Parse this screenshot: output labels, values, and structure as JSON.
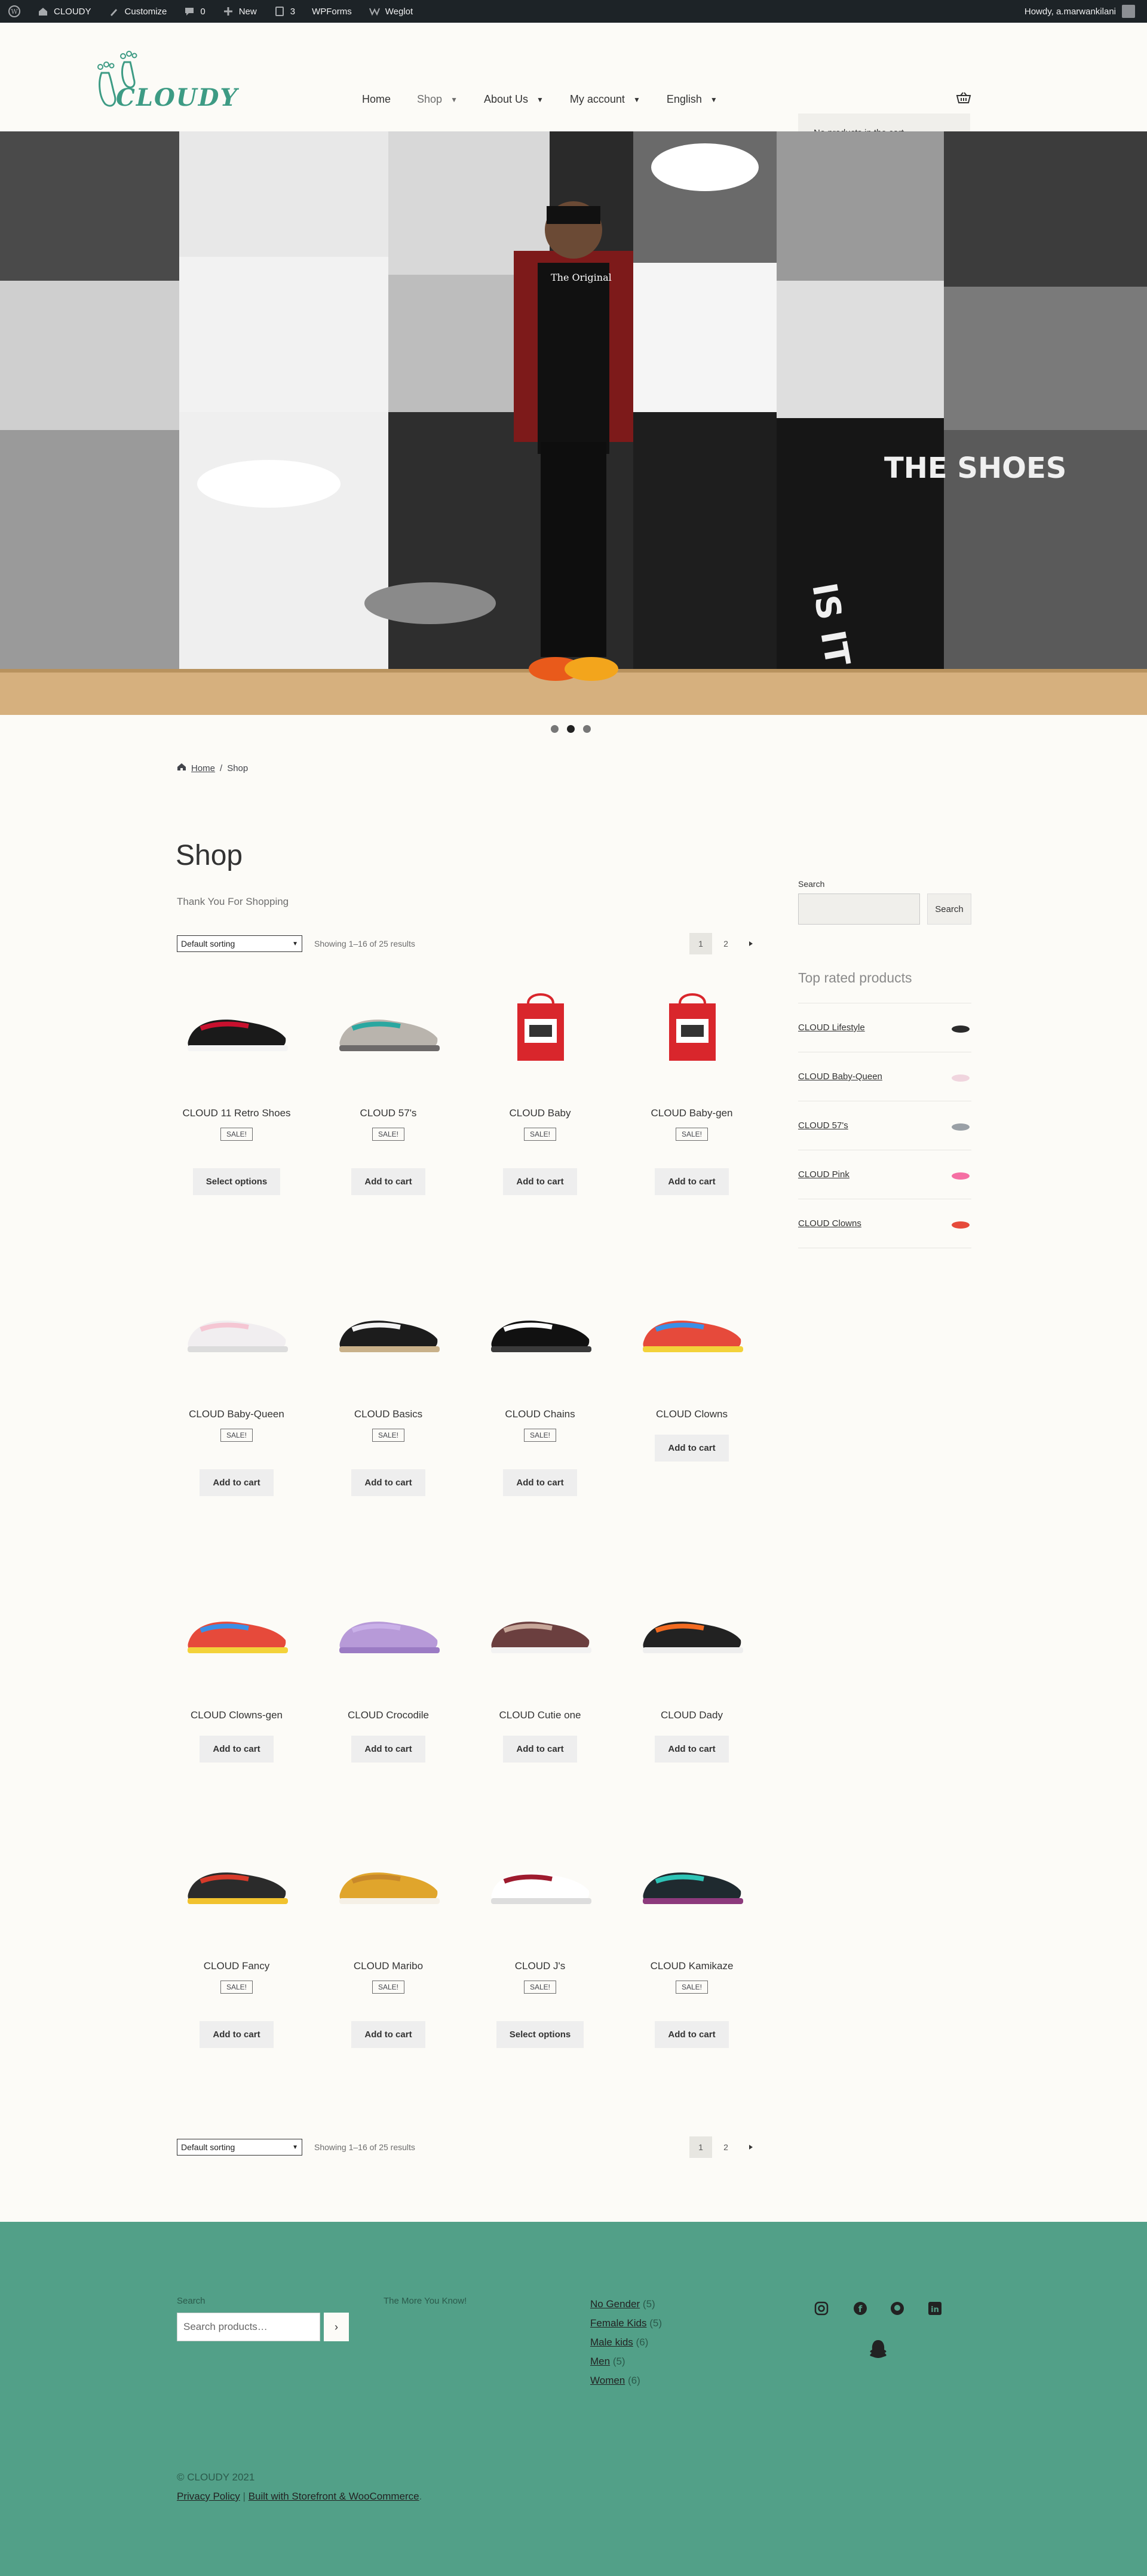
{
  "admin_bar": {
    "site_name": "CLOUDY",
    "customize": "Customize",
    "comments_count": "0",
    "new_label": "New",
    "updates_count": "3",
    "wpforms": "WPForms",
    "weglot": "Weglot",
    "howdy": "Howdy, a.marwankilani"
  },
  "header": {
    "logo_text": "CLOUDY",
    "nav": [
      "Home",
      "Shop",
      "About Us",
      "My account",
      "English"
    ],
    "cart_message": "No products in the cart."
  },
  "breadcrumb": {
    "home": "Home",
    "separator": "/",
    "current": "Shop"
  },
  "page": {
    "title": "Shop",
    "subtitle": "Thank You For Shopping"
  },
  "toolbar": {
    "sort_value": "Default sorting",
    "result_count": "Showing 1–16 of 25 results",
    "pages": [
      "1",
      "2"
    ],
    "next": "→"
  },
  "products": [
    {
      "name": "CLOUD 11 Retro Shoes",
      "sale": "SALE!",
      "button": "Select options",
      "colors": [
        "#1a1a1a",
        "#c8102e",
        "#f4f4f4"
      ]
    },
    {
      "name": "CLOUD 57's",
      "sale": "SALE!",
      "button": "Add to cart",
      "colors": [
        "#b9b4ad",
        "#2aa7a0",
        "#6d6a6a"
      ]
    },
    {
      "name": "CLOUD Baby",
      "sale": "SALE!",
      "button": "Add to cart",
      "colors": [
        "#d9262c",
        "#ffffff",
        "#333333"
      ]
    },
    {
      "name": "CLOUD Baby-gen",
      "sale": "SALE!",
      "button": "Add to cart",
      "colors": [
        "#d9262c",
        "#ffffff",
        "#333333"
      ]
    },
    {
      "name": "CLOUD Baby-Queen",
      "sale": "SALE!",
      "button": "Add to cart",
      "colors": [
        "#f1eef0",
        "#f5c6d3",
        "#dcdcdc"
      ]
    },
    {
      "name": "CLOUD Basics",
      "sale": "SALE!",
      "button": "Add to cart",
      "colors": [
        "#1c1c1c",
        "#f4f4f4",
        "#c9b18a"
      ]
    },
    {
      "name": "CLOUD Chains",
      "sale": "SALE!",
      "button": "Add to cart",
      "colors": [
        "#111111",
        "#ffffff",
        "#3a3a3a"
      ]
    },
    {
      "name": "CLOUD Clowns",
      "sale": "",
      "button": "Add to cart",
      "colors": [
        "#e64a3b",
        "#3b8fe6",
        "#f3d23a"
      ]
    },
    {
      "name": "CLOUD Clowns-gen",
      "sale": "",
      "button": "Add to cart",
      "colors": [
        "#e64a3b",
        "#3b8fe6",
        "#f3d23a"
      ]
    },
    {
      "name": "CLOUD Crocodile",
      "sale": "",
      "button": "Add to cart",
      "colors": [
        "#b79ad8",
        "#c9b0e8",
        "#9b7bc4"
      ]
    },
    {
      "name": "CLOUD Cutie one",
      "sale": "",
      "button": "Add to cart",
      "colors": [
        "#6b3f3f",
        "#c7a79a",
        "#f2f2f2"
      ]
    },
    {
      "name": "CLOUD Dady",
      "sale": "",
      "button": "Add to cart",
      "colors": [
        "#222222",
        "#f36b21",
        "#eeeeee"
      ]
    },
    {
      "name": "CLOUD Fancy",
      "sale": "SALE!",
      "button": "Add to cart",
      "colors": [
        "#2b2b2b",
        "#d73a2a",
        "#f1c22e"
      ]
    },
    {
      "name": "CLOUD Maribo",
      "sale": "SALE!",
      "button": "Add to cart",
      "colors": [
        "#e0a52c",
        "#c8882a",
        "#f5f0e6"
      ]
    },
    {
      "name": "CLOUD J's",
      "sale": "SALE!",
      "button": "Select options",
      "colors": [
        "#ffffff",
        "#9e1b2e",
        "#dddddd"
      ]
    },
    {
      "name": "CLOUD Kamikaze",
      "sale": "SALE!",
      "button": "Add to cart",
      "colors": [
        "#1f2a2f",
        "#2ec4b6",
        "#8c3a7c"
      ]
    }
  ],
  "sidebar": {
    "search_label": "Search",
    "search_button": "Search",
    "top_rated_title": "Top rated products",
    "top_rated": [
      "CLOUD Lifestyle",
      "CLOUD Baby-Queen",
      "CLOUD 57's",
      "CLOUD Pink",
      "CLOUD Clowns"
    ]
  },
  "footer": {
    "search_label": "Search",
    "search_placeholder": "Search products…",
    "search_button": "›",
    "tagline": "The More You Know!",
    "categories": [
      {
        "name": "No Gender",
        "count": "(5)"
      },
      {
        "name": "Female Kids",
        "count": "(5)"
      },
      {
        "name": "Male kids",
        "count": "(6)"
      },
      {
        "name": "Men",
        "count": "(5)"
      },
      {
        "name": "Women",
        "count": "(6)"
      }
    ],
    "social_icons": [
      "instagram-icon",
      "facebook-icon",
      "github-icon",
      "linkedin-icon",
      "snapchat-icon"
    ],
    "copyright": "© CLOUDY 2021",
    "privacy": "Privacy Policy",
    "built_with": "Built with Storefront & WooCommerce",
    "period": "."
  },
  "colors": {
    "brand": "#3d9b84",
    "footer_bg": "#52a088",
    "admin_bg": "#1d2327"
  }
}
